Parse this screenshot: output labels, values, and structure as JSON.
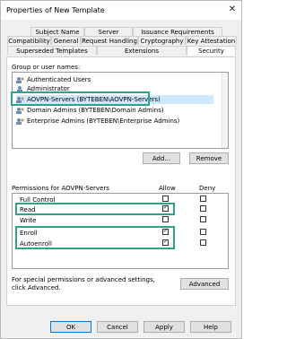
{
  "window": {
    "title": "Properties of New Template",
    "close_glyph": "✕"
  },
  "tabs_row1": [
    "Subject Name",
    "Server",
    "Issuance Requirements"
  ],
  "tabs_row2": [
    "Compatibility",
    "General",
    "Request Handling",
    "Cryptography",
    "Key Attestation"
  ],
  "tabs_row3": [
    "Superseded Templates",
    "Extensions",
    "Security"
  ],
  "security": {
    "group_label": "Group or user names:",
    "users": [
      {
        "name": "Authenticated Users",
        "selected": false
      },
      {
        "name": "Administrator",
        "selected": false
      },
      {
        "name": "AOVPN-Servers (BYTEBEN\\AOVPN-Servers)",
        "selected": true
      },
      {
        "name": "Domain Admins (BYTEBEN\\Domain Admins)",
        "selected": false
      },
      {
        "name": "Enterprise Admins (BYTEBEN\\Enterprise Admins)",
        "selected": false
      }
    ],
    "add_label": "Add...",
    "remove_label": "Remove",
    "permissions_label": "Permissions for AOVPN-Servers",
    "allow_header": "Allow",
    "deny_header": "Deny",
    "permissions": [
      {
        "name": "Full Control",
        "allow": false,
        "deny": false
      },
      {
        "name": "Read",
        "allow": true,
        "deny": false
      },
      {
        "name": "Write",
        "allow": false,
        "deny": false
      },
      {
        "name": "Enroll",
        "allow": true,
        "deny": false
      },
      {
        "name": "Autoenroll",
        "allow": true,
        "deny": false
      }
    ],
    "special_text": "For special permissions or advanced settings, click Advanced.",
    "advanced_label": "Advanced"
  },
  "footer": {
    "ok": "OK",
    "cancel": "Cancel",
    "apply": "Apply",
    "help": "Help"
  },
  "colors": {
    "highlight_box": "#2aa58a",
    "selection": "#cde8ff",
    "default_button_border": "#0078d7"
  }
}
